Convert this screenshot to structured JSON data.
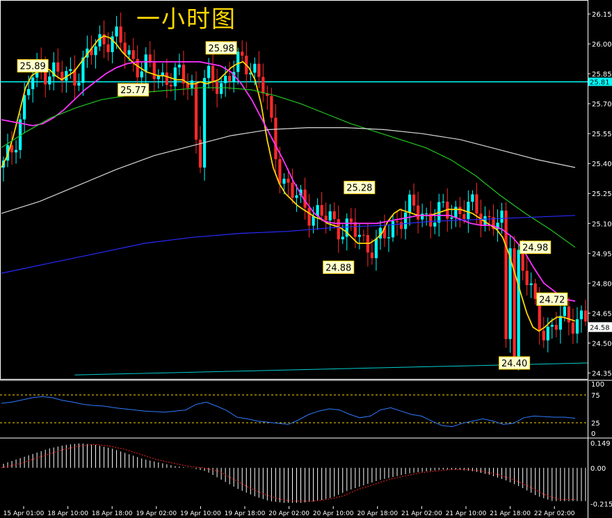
{
  "title": "一小时图",
  "colors": {
    "bg": "#000000",
    "axis": "#ffffff",
    "bull": "#00ffff",
    "bear": "#ff2a2a",
    "ema_fast": "#ffd700",
    "ma_mid": "#ff33ff",
    "ma_long": "#22c822",
    "ma_200": "#d8d8d8",
    "ma_blue": "#2a2aff",
    "hline": "#00ffff",
    "trend": "#00cfcf",
    "rsi": "#2f7bff",
    "rsi_level": "#ffd700",
    "macd_hist": "#ffffff",
    "macd_signal": "#ff2020",
    "label_bg": "#ffffcc",
    "label_border": "#ffd700"
  },
  "chart_data": [
    {
      "type": "candlestick",
      "name": "main",
      "ylim": [
        24.32,
        26.22
      ],
      "y_ticks": [
        "26.15",
        "26.00",
        "25.85",
        "25.70",
        "25.55",
        "25.40",
        "25.25",
        "25.10",
        "24.95",
        "24.80",
        "24.65",
        "24.50",
        "24.35"
      ],
      "y_tick_values": [
        26.15,
        26.0,
        25.85,
        25.7,
        25.55,
        25.4,
        25.25,
        25.1,
        24.95,
        24.8,
        24.65,
        24.5,
        24.35
      ],
      "x_labels": [
        "15 Apr 01:00",
        "18 Apr 10:00",
        "18 Apr 18:00",
        "19 Apr 02:00",
        "19 Apr 10:00",
        "19 Apr 18:00",
        "20 Apr 02:00",
        "20 Apr 10:00",
        "20 Apr 18:00",
        "21 Apr 02:00",
        "21 Apr 10:00",
        "21 Apr 18:00",
        "22 Apr 02:00"
      ],
      "current_price": "24.58",
      "current_price_value": 24.58,
      "horizontal_line": "25.81",
      "horizontal_line_value": 25.81,
      "annotations": [
        {
          "text": "25.89",
          "value": 25.89,
          "bar": 7
        },
        {
          "text": "25.98",
          "value": 25.98,
          "bar": 52
        },
        {
          "text": "25.77",
          "value": 25.77,
          "bar": 31
        },
        {
          "text": "24.88",
          "value": 24.88,
          "bar": 80
        },
        {
          "text": "25.28",
          "value": 25.28,
          "bar": 85
        },
        {
          "text": "24.98",
          "value": 24.98,
          "bar": 127
        },
        {
          "text": "24.72",
          "value": 24.72,
          "bar": 131
        },
        {
          "text": "24.40",
          "value": 24.4,
          "bar": 122
        }
      ],
      "trendline": {
        "from": [
          17,
          24.34
        ],
        "to": [
          136,
          24.4
        ]
      },
      "series": [
        {
          "name": "",
          "key": "ema_fast",
          "values": [
            25.38,
            25.44,
            25.54,
            25.66,
            25.78,
            25.84,
            25.86,
            25.88,
            25.87,
            25.84,
            25.82,
            25.84,
            25.86,
            25.9,
            25.94,
            25.98,
            26.02,
            26.04,
            26.03,
            26.0,
            25.96,
            25.93,
            25.9,
            25.88,
            25.86,
            25.85,
            25.84,
            25.84,
            25.83,
            25.82,
            25.82,
            25.8,
            25.8,
            25.81,
            25.8,
            25.81,
            25.82,
            25.85,
            25.88,
            25.9,
            25.91,
            25.88,
            25.82,
            25.7,
            25.52,
            25.38,
            25.3,
            25.25,
            25.22,
            25.19,
            25.17,
            25.15,
            25.13,
            25.12,
            25.1,
            25.09,
            25.08,
            25.06,
            25.03,
            25.0,
            25.0,
            25.0,
            25.02,
            25.05,
            25.11,
            25.15,
            25.17,
            25.16,
            25.15,
            25.14,
            25.14,
            25.14,
            25.15,
            25.16,
            25.17,
            25.17,
            25.17,
            25.16,
            25.15,
            25.13,
            25.11,
            25.09,
            25.07,
            25.03,
            24.95,
            24.85,
            24.75,
            24.65,
            24.58,
            24.56,
            24.58,
            24.61,
            24.63,
            24.63,
            24.62,
            24.61
          ]
        },
        {
          "name": "",
          "key": "ma_mid",
          "values": [
            25.62,
            25.61,
            25.6,
            25.59,
            25.6,
            25.63,
            25.67,
            25.72,
            25.77,
            25.81,
            25.85,
            25.88,
            25.9,
            25.91,
            25.91,
            25.91,
            25.91,
            25.91,
            25.91,
            25.91,
            25.9,
            25.89,
            25.86,
            25.8,
            25.72,
            25.62,
            25.52,
            25.42,
            25.31,
            25.22,
            25.15,
            25.11,
            25.1,
            25.1,
            25.1,
            25.1,
            25.1,
            25.11,
            25.12,
            25.13,
            25.14,
            25.14,
            25.14,
            25.14,
            25.12,
            25.1,
            25.09,
            25.09,
            25.07,
            25.03,
            24.97,
            24.88,
            24.8,
            24.76,
            24.72,
            24.71
          ]
        },
        {
          "name": "",
          "key": "ma_long",
          "values": [
            25.48,
            25.56,
            25.63,
            25.68,
            25.72,
            25.74,
            25.76,
            25.77,
            25.78,
            25.78,
            25.77,
            25.74,
            25.7,
            25.65,
            25.6,
            25.56,
            25.52,
            25.48,
            25.42,
            25.34,
            25.24,
            25.15,
            25.07,
            24.98
          ]
        },
        {
          "name": "",
          "key": "ma_200",
          "values": [
            25.15,
            25.21,
            25.29,
            25.37,
            25.44,
            25.49,
            25.54,
            25.57,
            25.58,
            25.58,
            25.57,
            25.55,
            25.52,
            25.47,
            25.42,
            25.38
          ]
        },
        {
          "name": "",
          "key": "ma_blue",
          "values": [
            24.85,
            24.9,
            24.95,
            25.0,
            25.03,
            25.05,
            25.06,
            25.08,
            25.09,
            25.11,
            25.12,
            25.13,
            25.14
          ]
        }
      ]
    },
    {
      "type": "line",
      "name": "rsi",
      "ylim": [
        0,
        100
      ],
      "y_ticks": [
        "100",
        "75",
        "25",
        "0"
      ],
      "y_tick_values": [
        100,
        75,
        25,
        0
      ],
      "levels": [
        75,
        25
      ],
      "values": [
        60,
        62,
        66,
        70,
        72,
        70,
        65,
        62,
        58,
        56,
        55,
        52,
        50,
        48,
        46,
        45,
        44,
        46,
        48,
        58,
        62,
        55,
        47,
        35,
        32,
        28,
        26,
        24,
        22,
        30,
        40,
        46,
        50,
        48,
        40,
        34,
        37,
        48,
        52,
        46,
        40,
        37,
        28,
        20,
        18,
        24,
        28,
        32,
        28,
        22,
        24,
        34,
        37,
        36,
        35,
        35,
        33
      ]
    },
    {
      "type": "bar",
      "name": "macd",
      "ylim": [
        -0.23,
        0.17
      ],
      "y_ticks": [
        "0.149",
        "0.00",
        "-0.215"
      ],
      "y_tick_values": [
        0.149,
        0.0,
        -0.215
      ],
      "signal_values": [
        0.0,
        0.02,
        0.05,
        0.08,
        0.11,
        0.13,
        0.14,
        0.13,
        0.11,
        0.08,
        0.05,
        0.03,
        0.01,
        0.0,
        -0.02,
        -0.07,
        -0.12,
        -0.16,
        -0.19,
        -0.2,
        -0.2,
        -0.19,
        -0.17,
        -0.13,
        -0.1,
        -0.07,
        -0.05,
        -0.03,
        -0.02,
        -0.01,
        -0.01,
        -0.02,
        -0.04,
        -0.07,
        -0.11,
        -0.16,
        -0.19,
        -0.19
      ]
    }
  ]
}
